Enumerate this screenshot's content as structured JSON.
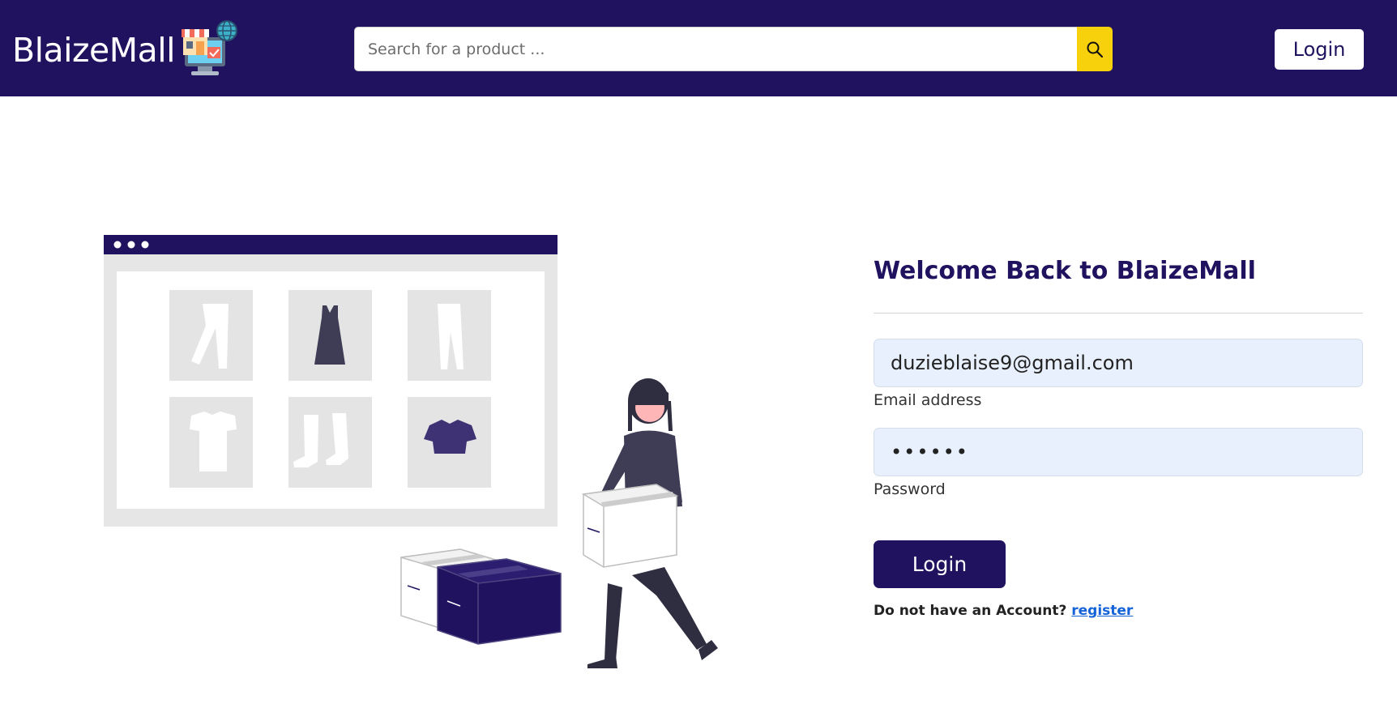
{
  "header": {
    "brand": "BlaizeMall",
    "logo_icon": "shop-globe-icon",
    "search_placeholder": "Search for a product ...",
    "search_icon": "search-icon",
    "login_label": "Login"
  },
  "form": {
    "title": "Welcome Back to BlaizeMall",
    "email_value": "duzieblaise9@gmail.com",
    "email_label": "Email address",
    "password_value": "••••••",
    "password_label": "Password",
    "submit_label": "Login",
    "no_account_text": "Do not have an Account?",
    "register_link": "register"
  },
  "colors": {
    "brand": "#211260",
    "search_button": "#f6d10c",
    "input_background": "#e8f0fe",
    "link": "#1463d8"
  }
}
